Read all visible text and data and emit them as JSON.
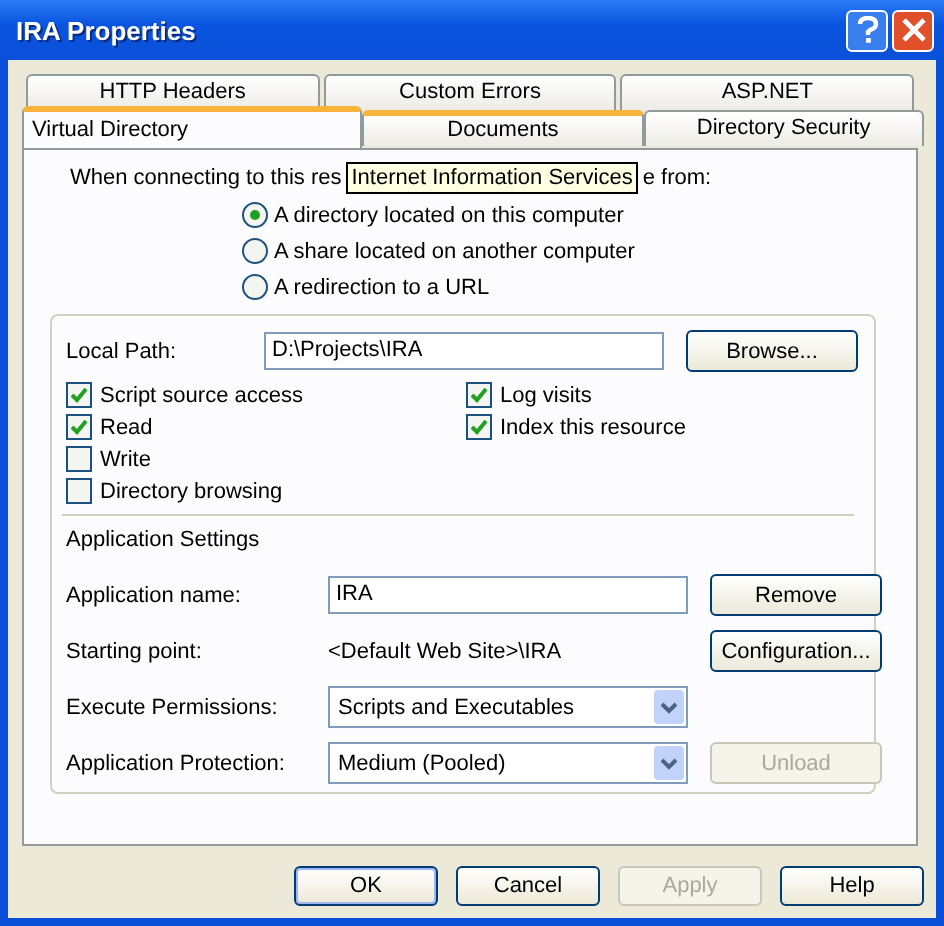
{
  "window": {
    "title": "IRA Properties"
  },
  "tab_rows": [
    [
      {
        "label": "HTTP Headers",
        "selected": false,
        "hot": false
      },
      {
        "label": "Custom Errors",
        "selected": false,
        "hot": false
      },
      {
        "label": "ASP.NET",
        "selected": false,
        "hot": false
      }
    ],
    [
      {
        "label": "Virtual Directory",
        "selected": true,
        "hot": false
      },
      {
        "label": "Documents",
        "selected": false,
        "hot": true
      },
      {
        "label": "Directory Security",
        "selected": false,
        "hot": false
      }
    ]
  ],
  "heading": {
    "before_tooltip": "When connecting to this res",
    "after_tooltip": "e from:"
  },
  "tooltip": "Internet Information Services",
  "source_options": [
    {
      "label": "A directory located on this computer",
      "selected": true
    },
    {
      "label": "A share located on another computer",
      "selected": false
    },
    {
      "label": "A redirection to a URL",
      "selected": false
    }
  ],
  "local_path": {
    "label": "Local Path:",
    "value": "D:\\Projects\\IRA",
    "button": "Browse..."
  },
  "checkboxes_left": [
    {
      "label": "Script source access",
      "checked": true
    },
    {
      "label": "Read",
      "checked": true
    },
    {
      "label": "Write",
      "checked": false
    },
    {
      "label": "Directory browsing",
      "checked": false
    }
  ],
  "checkboxes_right": [
    {
      "label": "Log visits",
      "checked": true
    },
    {
      "label": "Index this resource",
      "checked": true
    }
  ],
  "application_settings": {
    "title": "Application Settings",
    "rows": [
      {
        "kind": "input",
        "label": "Application name:",
        "value": "IRA",
        "button": "Remove",
        "button_disabled": false
      },
      {
        "kind": "text",
        "label": "Starting point:",
        "value": "<Default Web Site>\\IRA",
        "button": "Configuration...",
        "button_disabled": false
      },
      {
        "kind": "select",
        "label": "Execute Permissions:",
        "value": "Scripts and Executables"
      },
      {
        "kind": "select",
        "label": "Application Protection:",
        "value": "Medium (Pooled)",
        "button": "Unload",
        "button_disabled": true
      }
    ]
  },
  "buttons": [
    {
      "label": "OK",
      "disabled": false,
      "default": true
    },
    {
      "label": "Cancel",
      "disabled": false,
      "default": false
    },
    {
      "label": "Apply",
      "disabled": true,
      "default": false
    },
    {
      "label": "Help",
      "disabled": false,
      "default": false
    }
  ]
}
